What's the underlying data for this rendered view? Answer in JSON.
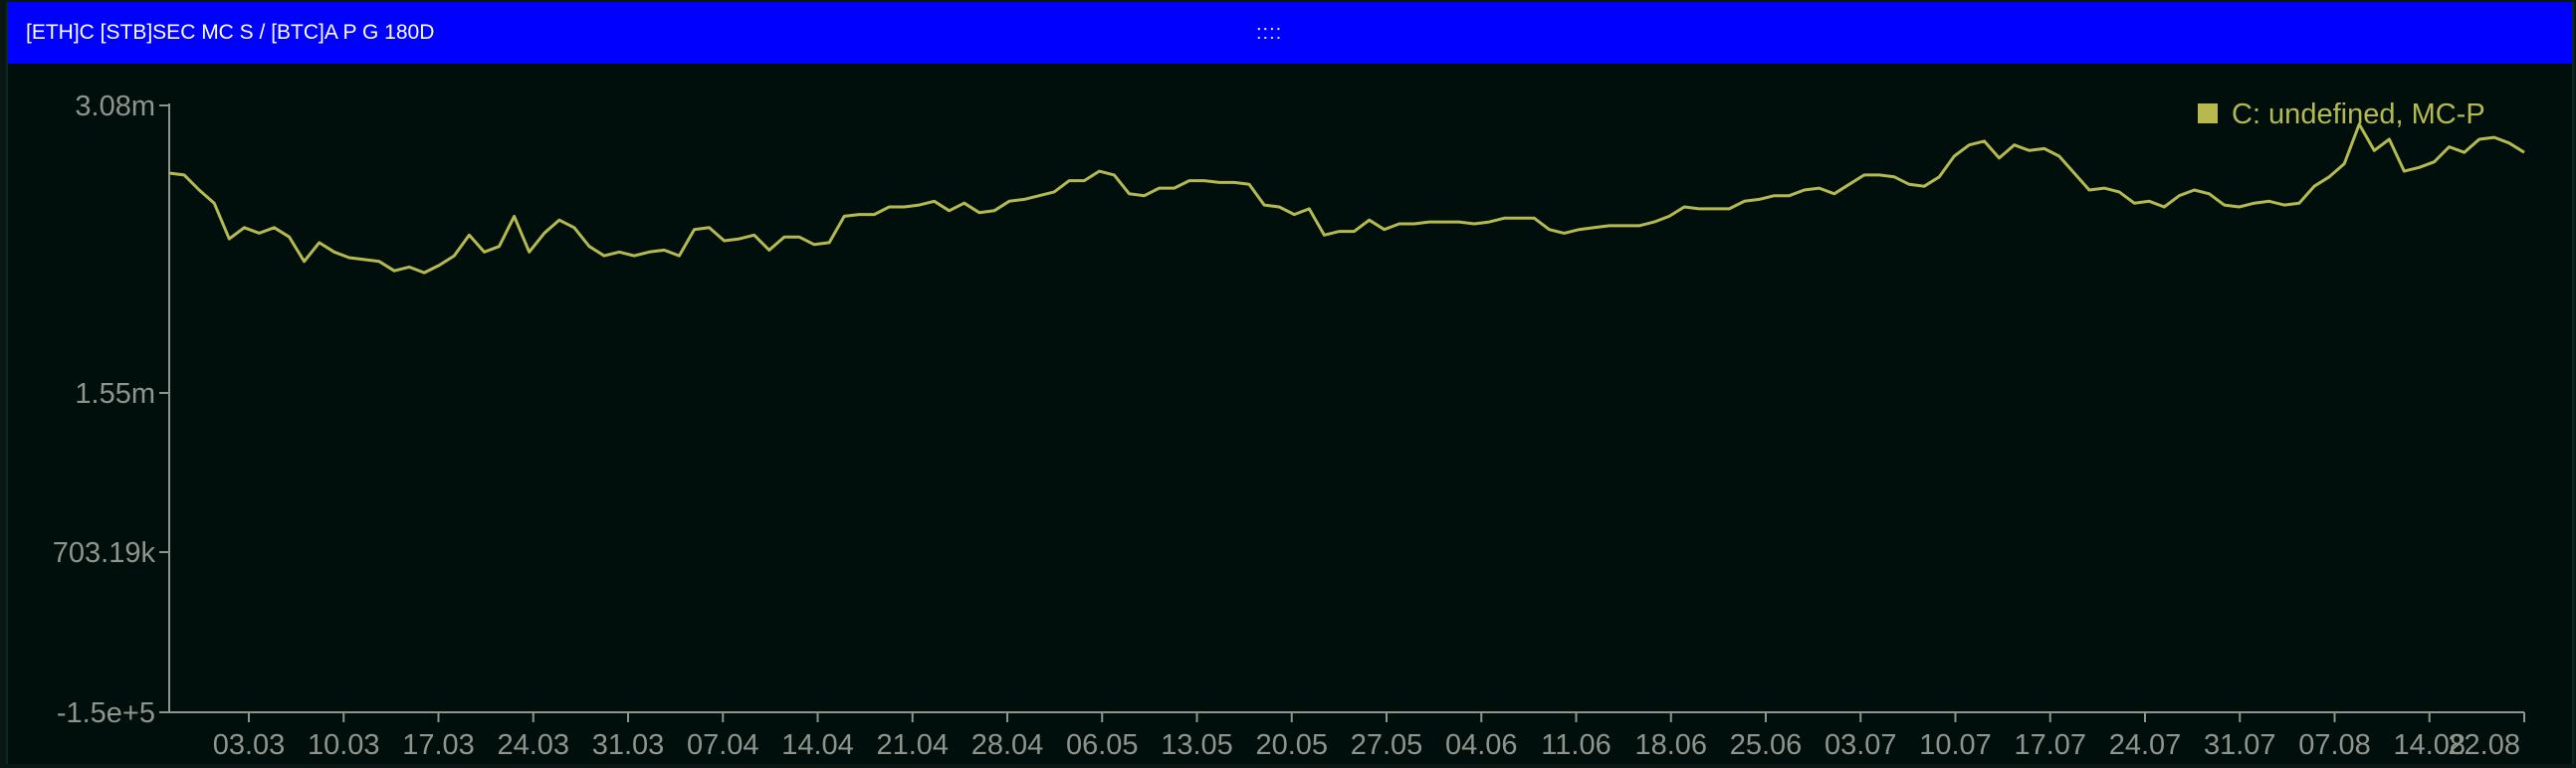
{
  "window": {
    "title": "[ETH]C [STB]SEC MC S / [BTC]A P G 180D",
    "drag_handle": "::::"
  },
  "colors": {
    "title_bar": "#0000ff",
    "background": "#000f0c",
    "series": "#b6ba4e",
    "axis_text": "#8f948c"
  },
  "chart_data": {
    "type": "line",
    "title": "",
    "xlabel": "",
    "ylabel": "",
    "y_ticks": [
      {
        "label": "3.08m",
        "value": 3080000
      },
      {
        "label": "1.55m",
        "value": 1550000
      },
      {
        "label": "703.19k",
        "value": 703190
      },
      {
        "label": "-1.5e+5",
        "value": -150000
      }
    ],
    "ylim": [
      -150000,
      3080000
    ],
    "x_ticks": [
      "03.03",
      "10.03",
      "17.03",
      "24.03",
      "31.03",
      "07.04",
      "14.04",
      "21.04",
      "28.04",
      "06.05",
      "13.05",
      "20.05",
      "27.05",
      "04.06",
      "11.06",
      "18.06",
      "25.06",
      "03.07",
      "10.07",
      "17.07",
      "24.07",
      "31.07",
      "07.08",
      "14.08",
      "22.08"
    ],
    "legend": {
      "placement": "top-right",
      "entries": [
        "C: undefined, MC-P"
      ]
    },
    "series": [
      {
        "name": "C: undefined, MC-P",
        "color": "#b6ba4e",
        "values": [
          2720000,
          2710000,
          2630000,
          2560000,
          2370000,
          2430000,
          2400000,
          2430000,
          2380000,
          2250000,
          2350000,
          2300000,
          2270000,
          2260000,
          2250000,
          2200000,
          2220000,
          2190000,
          2230000,
          2280000,
          2390000,
          2300000,
          2330000,
          2490000,
          2300000,
          2400000,
          2470000,
          2430000,
          2330000,
          2280000,
          2300000,
          2280000,
          2300000,
          2310000,
          2280000,
          2420000,
          2430000,
          2360000,
          2370000,
          2390000,
          2310000,
          2380000,
          2380000,
          2340000,
          2350000,
          2490000,
          2500000,
          2500000,
          2540000,
          2540000,
          2550000,
          2570000,
          2520000,
          2560000,
          2510000,
          2520000,
          2570000,
          2580000,
          2600000,
          2620000,
          2680000,
          2680000,
          2730000,
          2710000,
          2610000,
          2600000,
          2640000,
          2640000,
          2680000,
          2680000,
          2670000,
          2670000,
          2660000,
          2550000,
          2540000,
          2500000,
          2530000,
          2390000,
          2410000,
          2410000,
          2470000,
          2420000,
          2450000,
          2450000,
          2460000,
          2460000,
          2460000,
          2450000,
          2460000,
          2480000,
          2480000,
          2480000,
          2420000,
          2400000,
          2420000,
          2430000,
          2440000,
          2440000,
          2440000,
          2460000,
          2490000,
          2540000,
          2530000,
          2530000,
          2530000,
          2570000,
          2580000,
          2600000,
          2600000,
          2630000,
          2640000,
          2610000,
          2660000,
          2710000,
          2710000,
          2700000,
          2660000,
          2650000,
          2700000,
          2810000,
          2870000,
          2890000,
          2800000,
          2870000,
          2840000,
          2850000,
          2810000,
          2720000,
          2630000,
          2640000,
          2620000,
          2560000,
          2570000,
          2540000,
          2600000,
          2630000,
          2610000,
          2550000,
          2540000,
          2560000,
          2570000,
          2550000,
          2560000,
          2650000,
          2700000,
          2770000,
          2980000,
          2840000,
          2900000,
          2730000,
          2750000,
          2780000,
          2860000,
          2830000,
          2900000,
          2910000,
          2880000,
          2830000
        ]
      }
    ]
  }
}
